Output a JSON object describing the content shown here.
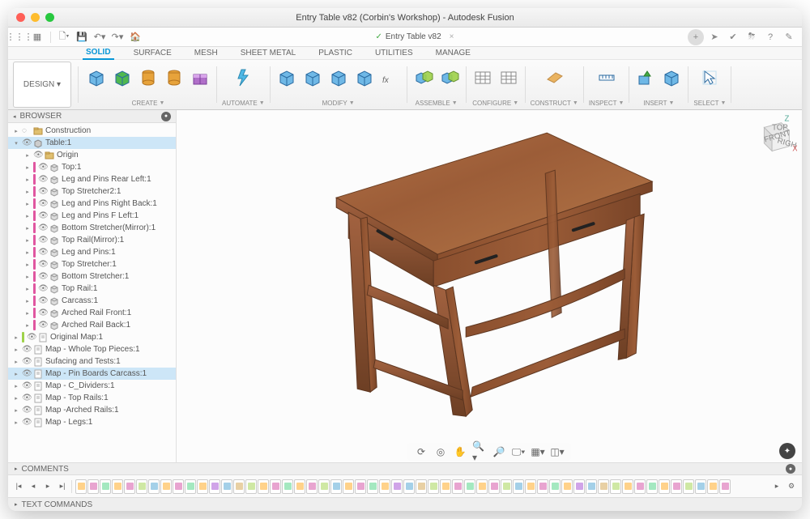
{
  "window": {
    "title": "Entry Table v82 (Corbin's Workshop) - Autodesk Fusion",
    "doc_tab": "Entry Table v82"
  },
  "quick": {
    "design_label": "DESIGN ▾"
  },
  "rightquick_items": [
    "+",
    "➤",
    "✔",
    "⛈",
    "?",
    "✎"
  ],
  "workspaces": [
    "SOLID",
    "SURFACE",
    "MESH",
    "SHEET METAL",
    "PLASTIC",
    "UTILITIES",
    "MANAGE"
  ],
  "ribbon": {
    "groups": [
      {
        "label": "CREATE",
        "dropdown": true,
        "icons": [
          {
            "c": "#6fb8e6",
            "n": "box-icon",
            "shape": "box"
          },
          {
            "c": "#4fb84f",
            "n": "extrude-icon",
            "shape": "box"
          },
          {
            "c": "#e7a33b",
            "n": "revolve-icon",
            "shape": "cyl"
          },
          {
            "c": "#e7a33b",
            "n": "hole-icon",
            "shape": "cyl"
          },
          {
            "c": "#b06fc9",
            "n": "form-icon",
            "shape": "gift"
          }
        ]
      },
      {
        "label": "AUTOMATE",
        "dropdown": true,
        "icons": [
          {
            "c": "#4fb8e6",
            "n": "script-icon",
            "shape": "bolt"
          }
        ]
      },
      {
        "label": "MODIFY",
        "dropdown": true,
        "icons": [
          {
            "c": "#6fb8e6",
            "n": "pressp-icon",
            "shape": "box"
          },
          {
            "c": "#6fb8e6",
            "n": "fillet-icon",
            "shape": "box"
          },
          {
            "c": "#6fb8e6",
            "n": "shell-icon",
            "shape": "box"
          },
          {
            "c": "#6fb8e6",
            "n": "draft-icon",
            "shape": "box"
          },
          {
            "c": "#777",
            "n": "param-icon",
            "shape": "fx"
          }
        ]
      },
      {
        "label": "ASSEMBLE",
        "dropdown": true,
        "icons": [
          {
            "c": "#6fb8e6",
            "n": "joint-icon",
            "shape": "boxg"
          },
          {
            "c": "#6fb8e6",
            "n": "asbuilt-icon",
            "shape": "boxg"
          }
        ]
      },
      {
        "label": "CONFIGURE",
        "dropdown": true,
        "icons": [
          {
            "c": "#888",
            "n": "config-icon",
            "shape": "grid"
          },
          {
            "c": "#888",
            "n": "config2-icon",
            "shape": "grid"
          }
        ]
      },
      {
        "label": "CONSTRUCT",
        "dropdown": true,
        "icons": [
          {
            "c": "#e7a33b",
            "n": "plane-icon",
            "shape": "plane"
          }
        ]
      },
      {
        "label": "INSPECT",
        "dropdown": true,
        "icons": [
          {
            "c": "#6fb8e6",
            "n": "measure-icon",
            "shape": "ruler"
          }
        ]
      },
      {
        "label": "INSERT",
        "dropdown": true,
        "icons": [
          {
            "c": "#6fb8e6",
            "n": "insert-icon",
            "shape": "arrow"
          },
          {
            "c": "#6fb8e6",
            "n": "decal-icon",
            "shape": "box"
          }
        ]
      },
      {
        "label": "SELECT",
        "dropdown": true,
        "icons": [
          {
            "c": "#6fb8e6",
            "n": "select-icon",
            "shape": "cursor"
          }
        ]
      }
    ]
  },
  "browser": {
    "title": "BROWSER",
    "nodes": [
      {
        "ind": 0,
        "exp": "▸",
        "eye": false,
        "color": "",
        "ico": "folder",
        "label": "Construction",
        "sel": false
      },
      {
        "ind": 0,
        "exp": "▾",
        "eye": true,
        "color": "",
        "ico": "comp",
        "label": "Table:1",
        "sel": true
      },
      {
        "ind": 1,
        "exp": "▸",
        "eye": true,
        "color": "",
        "ico": "folder",
        "label": "Origin",
        "sel": false
      },
      {
        "ind": 1,
        "exp": "▸",
        "eye": true,
        "color": "#e056a0",
        "ico": "body",
        "label": "Top:1",
        "sel": false
      },
      {
        "ind": 1,
        "exp": "▸",
        "eye": true,
        "color": "#e056a0",
        "ico": "body",
        "label": "Leg and Pins Rear Left:1",
        "sel": false
      },
      {
        "ind": 1,
        "exp": "▸",
        "eye": true,
        "color": "#e056a0",
        "ico": "body",
        "label": "Top Stretcher2:1",
        "sel": false
      },
      {
        "ind": 1,
        "exp": "▸",
        "eye": true,
        "color": "#e056a0",
        "ico": "body",
        "label": "Leg and Pins Right Back:1",
        "sel": false
      },
      {
        "ind": 1,
        "exp": "▸",
        "eye": true,
        "color": "#e056a0",
        "ico": "body",
        "label": "Leg and Pins F Left:1",
        "sel": false
      },
      {
        "ind": 1,
        "exp": "▸",
        "eye": true,
        "color": "#e056a0",
        "ico": "body",
        "label": "Bottom Stretcher(Mirror):1",
        "sel": false
      },
      {
        "ind": 1,
        "exp": "▸",
        "eye": true,
        "color": "#e056a0",
        "ico": "body",
        "label": "Top Rail(Mirror):1",
        "sel": false
      },
      {
        "ind": 1,
        "exp": "▸",
        "eye": true,
        "color": "#e056a0",
        "ico": "body",
        "label": "Leg and Pins:1",
        "sel": false
      },
      {
        "ind": 1,
        "exp": "▸",
        "eye": true,
        "color": "#e056a0",
        "ico": "body",
        "label": "Top Stretcher:1",
        "sel": false
      },
      {
        "ind": 1,
        "exp": "▸",
        "eye": true,
        "color": "#e056a0",
        "ico": "body",
        "label": "Bottom Stretcher:1",
        "sel": false
      },
      {
        "ind": 1,
        "exp": "▸",
        "eye": true,
        "color": "#e056a0",
        "ico": "body",
        "label": "Top Rail:1",
        "sel": false
      },
      {
        "ind": 1,
        "exp": "▸",
        "eye": true,
        "color": "#e056a0",
        "ico": "body",
        "label": "Carcass:1",
        "sel": false
      },
      {
        "ind": 1,
        "exp": "▸",
        "eye": true,
        "color": "#e056a0",
        "ico": "body",
        "label": "Arched Rail Front:1",
        "sel": false
      },
      {
        "ind": 1,
        "exp": "▸",
        "eye": true,
        "color": "#e056a0",
        "ico": "body",
        "label": "Arched Rail Back:1",
        "sel": false
      },
      {
        "ind": 0,
        "exp": "▸",
        "eye": true,
        "color": "#9fd24a",
        "ico": "draw",
        "label": "Original Map:1",
        "sel": false
      },
      {
        "ind": 0,
        "exp": "▸",
        "eye": true,
        "color": "",
        "ico": "draw",
        "label": "Map - Whole Top Pieces:1",
        "sel": false
      },
      {
        "ind": 0,
        "exp": "▸",
        "eye": true,
        "color": "",
        "ico": "draw",
        "label": "Sufacing and Tests:1",
        "sel": false
      },
      {
        "ind": 0,
        "exp": "▸",
        "eye": true,
        "color": "",
        "ico": "draw",
        "label": "Map - Pin Boards Carcass:1",
        "sel": true
      },
      {
        "ind": 0,
        "exp": "▸",
        "eye": true,
        "color": "",
        "ico": "draw",
        "label": "Map - C_Dividers:1",
        "sel": false
      },
      {
        "ind": 0,
        "exp": "▸",
        "eye": true,
        "color": "",
        "ico": "draw",
        "label": "Map - Top Rails:1",
        "sel": false
      },
      {
        "ind": 0,
        "exp": "▸",
        "eye": true,
        "color": "",
        "ico": "draw",
        "label": "Map -Arched Rails:1",
        "sel": false
      },
      {
        "ind": 0,
        "exp": "▸",
        "eye": true,
        "color": "",
        "ico": "draw",
        "label": "Map - Legs:1",
        "sel": false
      }
    ]
  },
  "comments": {
    "title": "COMMENTS"
  },
  "textcmd": {
    "title": "TEXT COMMANDS"
  },
  "timeline_colors": [
    "#ffd28a",
    "#e8a4d0",
    "#a4e8c0",
    "#ffd28a",
    "#e8a4d0",
    "#cfe8a4",
    "#a4d0e8",
    "#ffd28a",
    "#e8a4d0",
    "#a4e8c0",
    "#ffd28a",
    "#d0a4e8",
    "#a4d0e8",
    "#e8d0a4",
    "#cfe8a4",
    "#ffd28a",
    "#e8a4d0",
    "#a4e8c0",
    "#ffd28a",
    "#e8a4d0",
    "#cfe8a4",
    "#a4d0e8",
    "#ffd28a",
    "#e8a4d0",
    "#a4e8c0",
    "#ffd28a",
    "#d0a4e8",
    "#a4d0e8",
    "#e8d0a4",
    "#cfe8a4",
    "#ffd28a",
    "#e8a4d0",
    "#a4e8c0",
    "#ffd28a",
    "#e8a4d0",
    "#cfe8a4",
    "#a4d0e8",
    "#ffd28a",
    "#e8a4d0",
    "#a4e8c0",
    "#ffd28a",
    "#d0a4e8",
    "#a4d0e8",
    "#e8d0a4",
    "#cfe8a4",
    "#ffd28a",
    "#e8a4d0",
    "#a4e8c0",
    "#ffd28a",
    "#e8a4d0",
    "#cfe8a4",
    "#a4d0e8",
    "#ffd28a",
    "#e8a4d0"
  ]
}
